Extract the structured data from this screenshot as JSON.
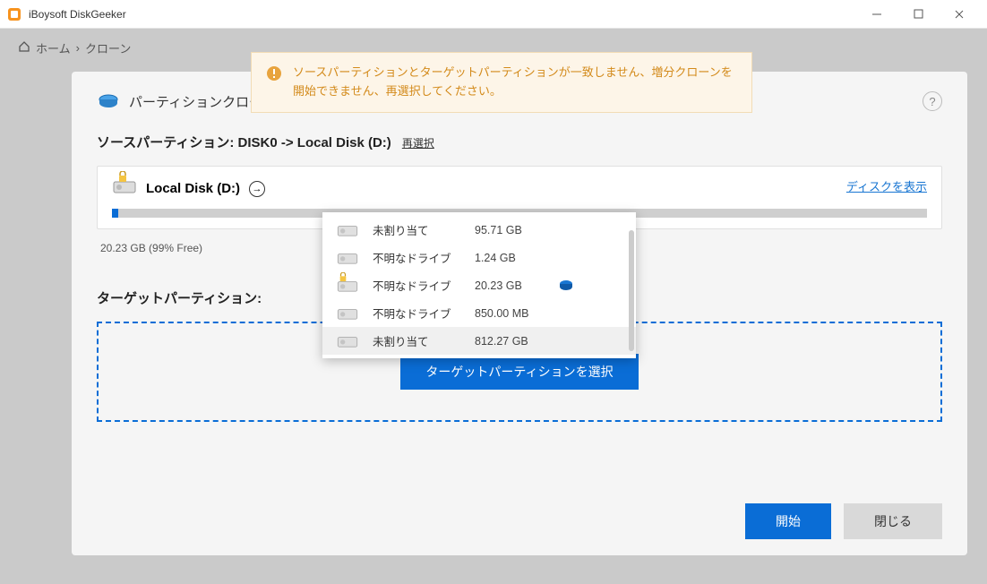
{
  "app": {
    "title": "iBoysoft DiskGeeker"
  },
  "breadcrumb": {
    "home": "ホーム",
    "sep": "›",
    "page": "クローン"
  },
  "toast": {
    "message": "ソースパーティションとターゲットパーティションが一致しません、増分クローンを開始できません、再選択してください。"
  },
  "panel": {
    "title": "パーティションクロー",
    "source_label": "ソースパーティション: DISK0 -> Local Disk (D:)",
    "reselect": "再選択",
    "show_disk": "ディスクを表示",
    "disk_name": "Local Disk (D:)",
    "disk_meta": "20.23 GB (99% Free)",
    "target_label": "ターゲットパーティション:",
    "select_target": "ターゲットパーティションを選択"
  },
  "dropdown": {
    "items": [
      {
        "label": "未割り当て",
        "size": "95.71 GB",
        "locked": false,
        "selected": false
      },
      {
        "label": "不明なドライブ",
        "size": "1.24 GB",
        "locked": false,
        "selected": false
      },
      {
        "label": "不明なドライブ",
        "size": "20.23 GB",
        "locked": true,
        "selected": true
      },
      {
        "label": "不明なドライブ",
        "size": "850.00 MB",
        "locked": false,
        "selected": false
      },
      {
        "label": "未割り当て",
        "size": "812.27 GB",
        "locked": false,
        "selected": false
      }
    ]
  },
  "footer": {
    "start": "開始",
    "close": "閉じる"
  }
}
